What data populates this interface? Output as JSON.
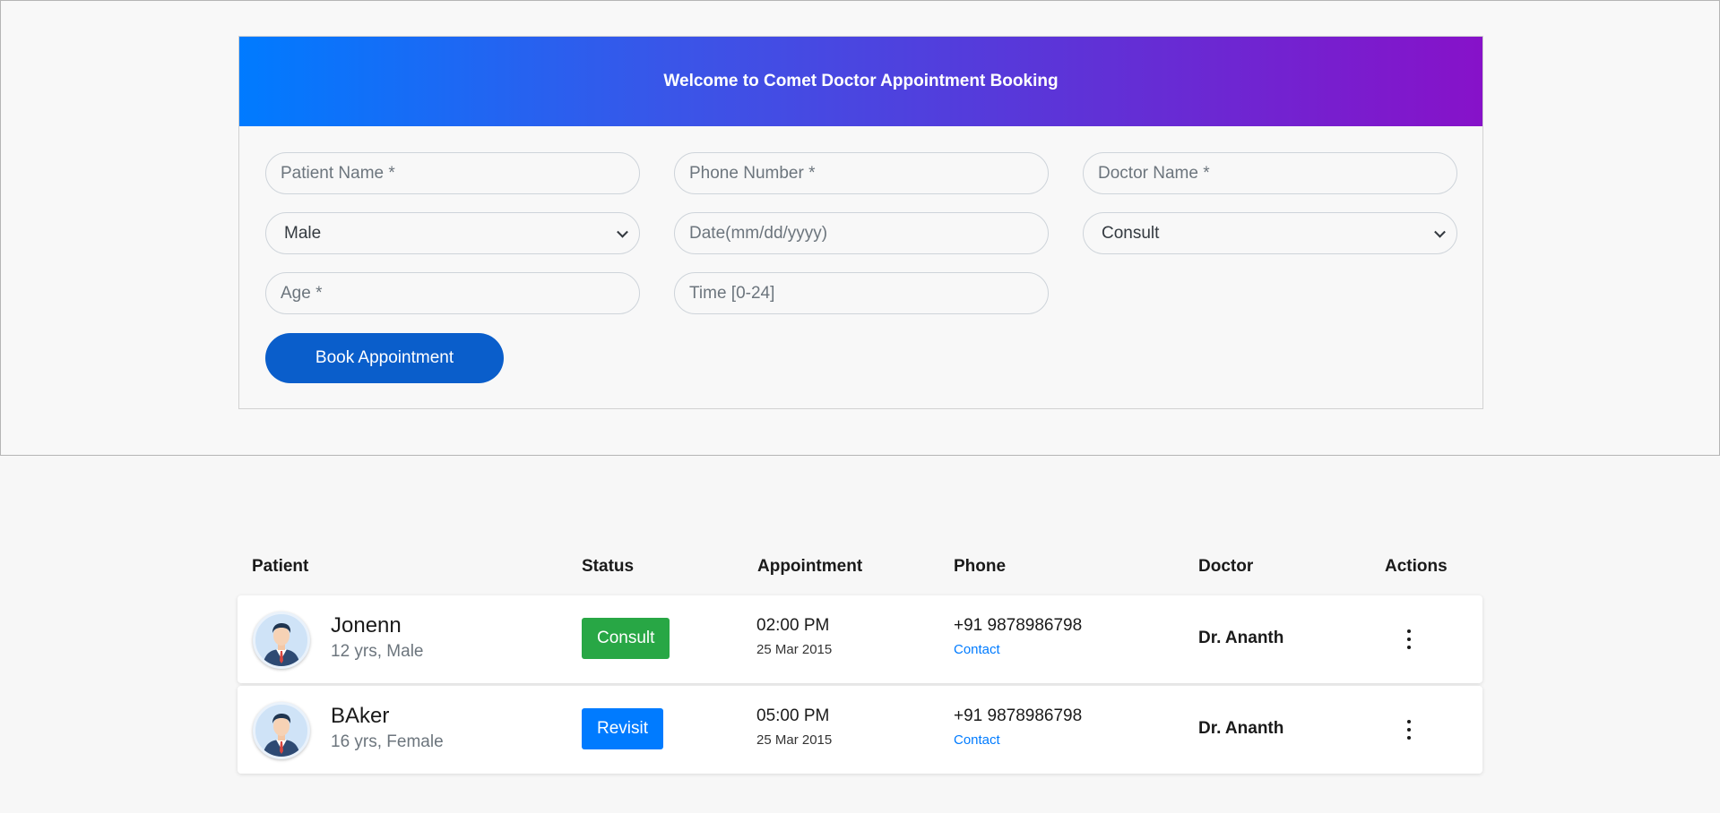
{
  "header": {
    "title": "Welcome to Comet Doctor Appointment Booking"
  },
  "form": {
    "patient_name_placeholder": "Patient Name *",
    "phone_placeholder": "Phone Number *",
    "doctor_placeholder": "Doctor Name *",
    "gender_value": "Male",
    "date_placeholder": "Date(mm/dd/yyyy)",
    "type_value": "Consult",
    "age_placeholder": "Age *",
    "time_placeholder": "Time [0-24]",
    "book_label": "Book Appointment"
  },
  "table": {
    "columns": [
      "Patient",
      "Status",
      "Appointment",
      "Phone",
      "Doctor",
      "Actions"
    ],
    "rows": [
      {
        "name": "Jonenn",
        "details": "12 yrs, Male",
        "status": "Consult",
        "time": "02:00 PM",
        "date": "25 Mar 2015",
        "phone": "+91 9878986798",
        "contact_label": "Contact",
        "doctor": "Dr. Ananth"
      },
      {
        "name": "BAker",
        "details": "16 yrs, Female",
        "status": "Revisit",
        "time": "05:00 PM",
        "date": "25 Mar 2015",
        "phone": "+91 9878986798",
        "contact_label": "Contact",
        "doctor": "Dr. Ananth"
      }
    ]
  },
  "icons": {
    "avatar": "doctor-avatar-icon",
    "actions": "more-vertical-icon",
    "dropdown": "chevron-down-icon"
  },
  "colors": {
    "header_gradient_start": "#007bff",
    "header_gradient_end": "#8712c9",
    "book_button": "#0a5ecb",
    "status_consult": "#28a745",
    "status_revisit": "#007bff",
    "link": "#007bff"
  }
}
